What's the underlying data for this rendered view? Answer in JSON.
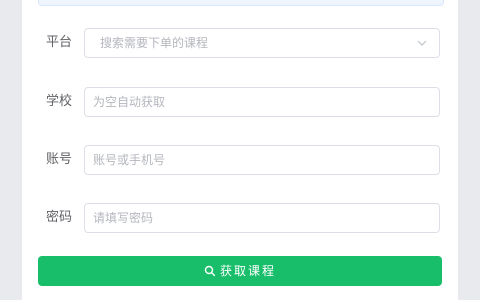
{
  "form": {
    "platform": {
      "label": "平台",
      "placeholder": "搜索需要下单的课程",
      "icon": "chevron-down-icon"
    },
    "school": {
      "label": "学校",
      "placeholder": "为空自动获取"
    },
    "account": {
      "label": "账号",
      "placeholder": "账号或手机号"
    },
    "password": {
      "label": "密码",
      "placeholder": "请填写密码"
    },
    "submit": {
      "label": "获取课程",
      "icon": "search-icon"
    }
  },
  "colors": {
    "primary": "#19be6b",
    "border": "#dcdfe6",
    "placeholder": "#b4b7bd",
    "label": "#606266",
    "background": "#e9eaed",
    "notice": "#eef5ff"
  }
}
